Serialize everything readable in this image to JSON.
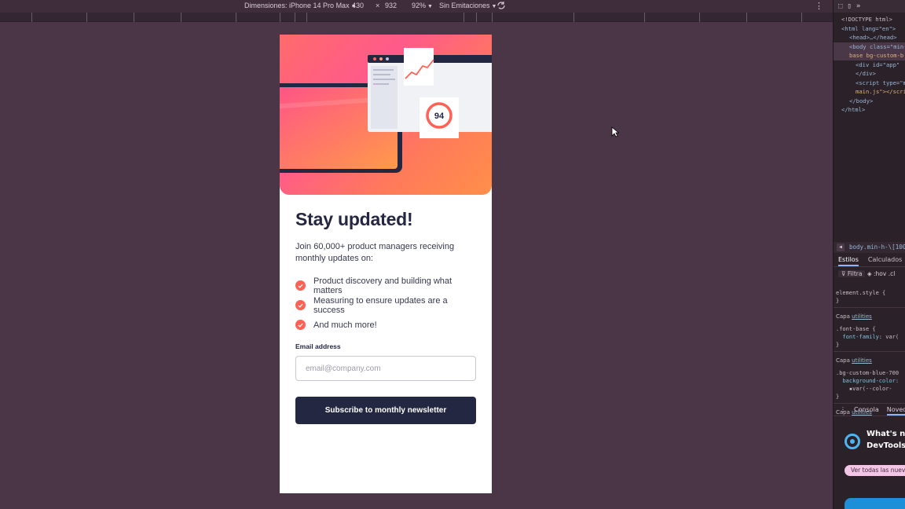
{
  "toolbar": {
    "dimensions_label": "Dimensiones: iPhone 14 Pro Max",
    "width": "430",
    "times": "×",
    "height": "932",
    "zoom": "92%",
    "throttling": "Sin Emitaciones"
  },
  "card": {
    "title": "Stay updated!",
    "intro": "Join 60,000+ product managers receiving monthly updates on:",
    "features": [
      "Product discovery and building what matters",
      "Measuring to ensure updates are a success",
      "And much more!"
    ],
    "score": "94",
    "email_label": "Email address",
    "email_placeholder": "email@company.com",
    "submit_label": "Subscribe to monthly newsletter"
  },
  "colors": {
    "title": "#242742",
    "accent": "#ff6155",
    "button": "#242742",
    "page_background": "#4b3648"
  },
  "devtools": {
    "code_lines": [
      "<!DOCTYPE html>",
      "<html lang=\"en\">",
      "<head>…</head>",
      "<body class=\"min-",
      "base bg-custom-b",
      "<div id=\"app\"",
      "</div>",
      "<script type=\"m",
      "main.js\"></scri",
      "</body>",
      "</html>"
    ],
    "breadcrumb": "body.min-h-\\[100dv",
    "tab_styles": "Estilos",
    "tab_computed": "Calculados",
    "filter": "Filtra",
    "hov": ":hov",
    "cls": ".cl",
    "element_style": "element.style {",
    "close_brace": "}",
    "capa_label": "Capa",
    "capa_link": "utilities",
    "rule1_selector": ".font-base {",
    "rule1_prop": "font-family",
    "rule1_value": ": var(",
    "rule2_selector": ".bg-custom-blue-700",
    "rule2_prop": "background-color",
    "rule2_value": "var(--color-",
    "console_tab": "Consola",
    "news_tab": "Noved",
    "whats_new_line1": "What's new",
    "whats_new_line2": "DevTools",
    "see_all": "Ver todas las nueva"
  }
}
